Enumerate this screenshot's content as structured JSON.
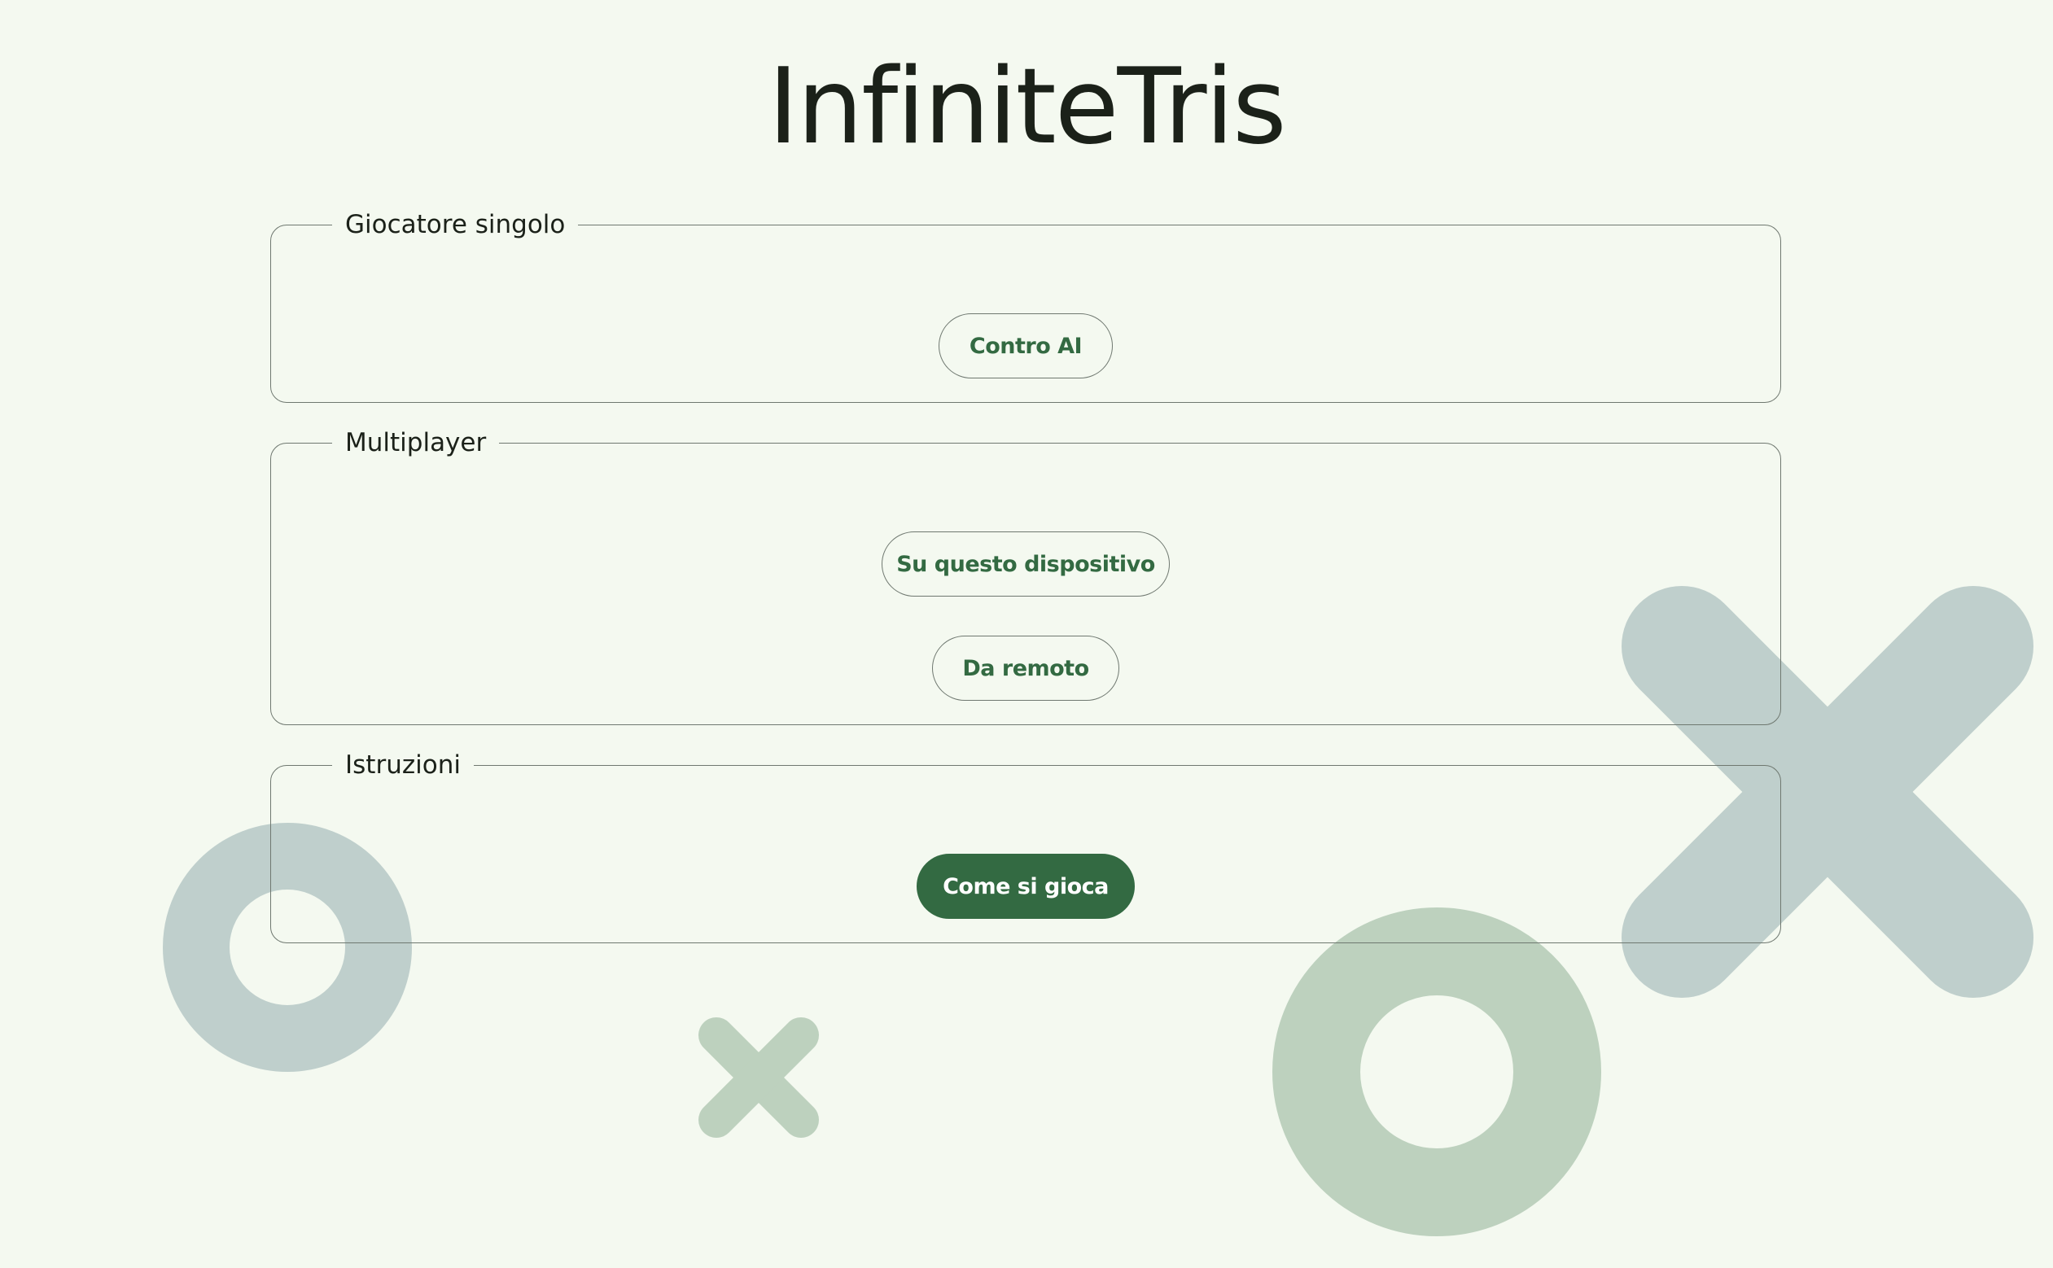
{
  "app": {
    "title": "InfiniteTris"
  },
  "sections": {
    "single": {
      "legend": "Giocatore singolo",
      "buttons": {
        "vs_ai": "Contro AI"
      }
    },
    "multiplayer": {
      "legend": "Multiplayer",
      "buttons": {
        "local": "Su questo dispositivo",
        "remote": "Da remoto"
      }
    },
    "instructions": {
      "legend": "Istruzioni",
      "buttons": {
        "how_to_play": "Come si gioca"
      }
    }
  },
  "decorations": {
    "shapes": [
      "o-mark-icon",
      "x-mark-icon",
      "o-mark-icon",
      "x-mark-icon"
    ]
  },
  "colors": {
    "background": "#f4f9f0",
    "accent": "#336a42",
    "text": "#1b2119",
    "outline": "#6f7870",
    "deco_blue": "#bfcfcc",
    "deco_green": "#bdd1be"
  }
}
